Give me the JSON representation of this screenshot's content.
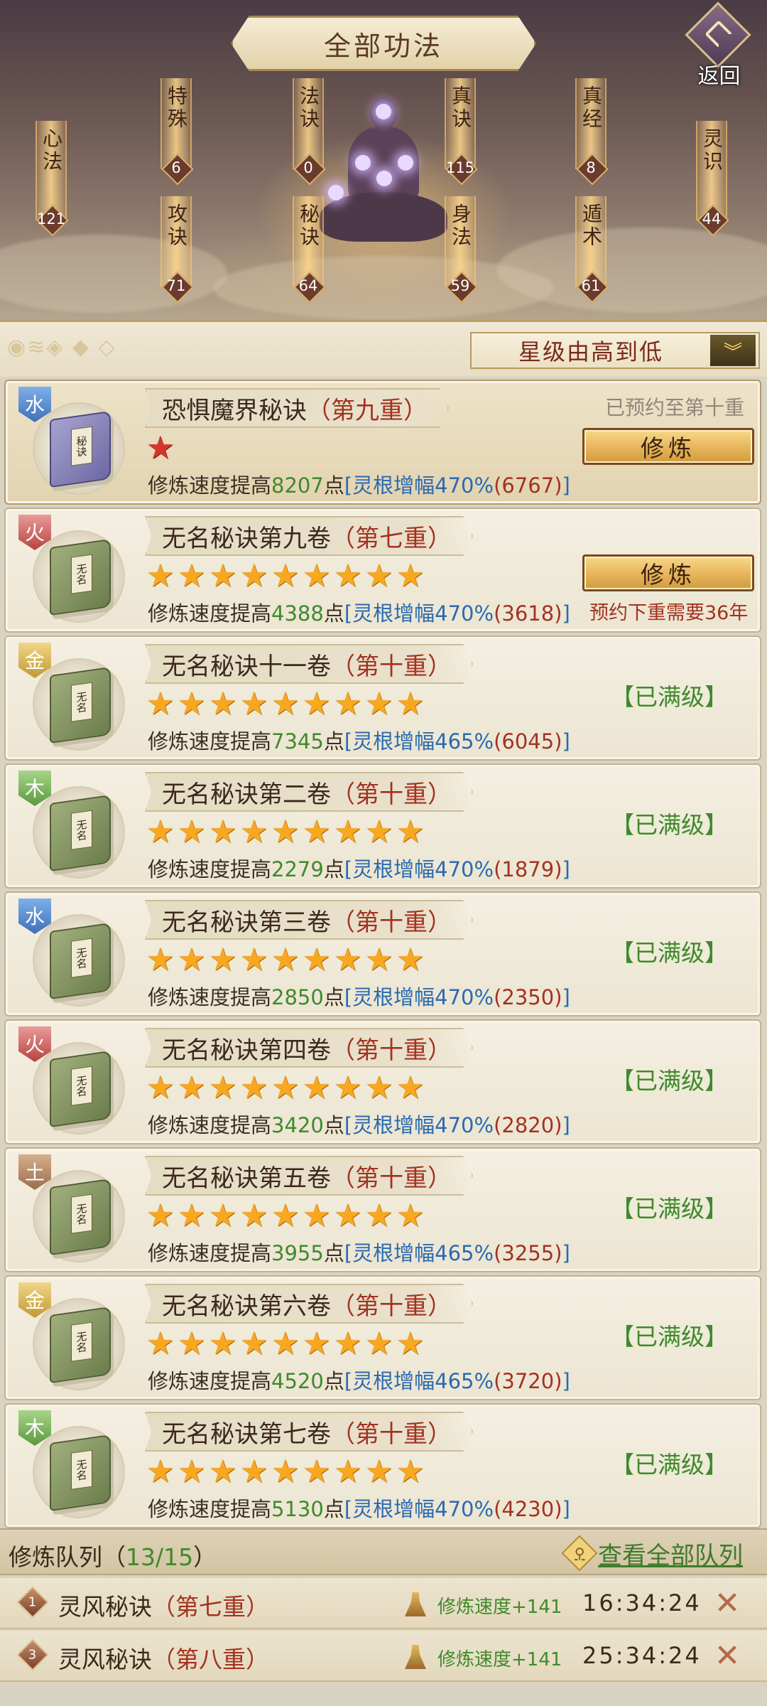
{
  "header": {
    "title": "全部功法",
    "back_label": "返回",
    "categories": [
      {
        "name": "心法",
        "count": "121"
      },
      {
        "name": "特殊",
        "count": "6"
      },
      {
        "name": "攻诀",
        "count": "71"
      },
      {
        "name": "法诀",
        "count": "0"
      },
      {
        "name": "秘诀",
        "count": "64"
      },
      {
        "name": "真诀",
        "count": "115"
      },
      {
        "name": "身法",
        "count": "59"
      },
      {
        "name": "真经",
        "count": "8"
      },
      {
        "name": "遁术",
        "count": "61"
      },
      {
        "name": "灵识",
        "count": "44"
      }
    ]
  },
  "sort": {
    "label": "星级由高到低"
  },
  "cards": [
    {
      "element": "水",
      "name": "恐惧魔界秘诀",
      "tier": "（第九重）",
      "book": "purple",
      "book_label": "秘诀",
      "stars": 1,
      "star_color": "red",
      "stat_prefix": "修炼速度提高",
      "speed": "8207",
      "stat_unit": "点",
      "bonus": "[灵根增幅470%",
      "bonus_value": "(6767)",
      "bracket_close": "]",
      "reserved_note": "已预约至第十重",
      "action": "修炼",
      "next_note": "",
      "maxed": ""
    },
    {
      "element": "火",
      "name": "无名秘诀第九卷",
      "tier": "（第七重）",
      "book": "green",
      "book_label": "无名",
      "stars": 9,
      "star_color": "gold",
      "stat_prefix": "修炼速度提高",
      "speed": "4388",
      "stat_unit": "点",
      "bonus": "[灵根增幅470%",
      "bonus_value": "(3618)",
      "bracket_close": "]",
      "reserved_note": "",
      "action": "修炼",
      "next_note": "预约下重需要36年",
      "maxed": ""
    },
    {
      "element": "金",
      "name": "无名秘诀十一卷",
      "tier": "（第十重）",
      "book": "green",
      "book_label": "无名",
      "stars": 9,
      "star_color": "gold",
      "stat_prefix": "修炼速度提高",
      "speed": "7345",
      "stat_unit": "点",
      "bonus": "[灵根增幅465%",
      "bonus_value": "(6045)",
      "bracket_close": "]",
      "reserved_note": "",
      "action": "",
      "next_note": "",
      "maxed": "【已满级】"
    },
    {
      "element": "木",
      "name": "无名秘诀第二卷",
      "tier": "（第十重）",
      "book": "green",
      "book_label": "无名",
      "stars": 9,
      "star_color": "gold",
      "stat_prefix": "修炼速度提高",
      "speed": "2279",
      "stat_unit": "点",
      "bonus": "[灵根增幅470%",
      "bonus_value": "(1879)",
      "bracket_close": "]",
      "reserved_note": "",
      "action": "",
      "next_note": "",
      "maxed": "【已满级】"
    },
    {
      "element": "水",
      "name": "无名秘诀第三卷",
      "tier": "（第十重）",
      "book": "green",
      "book_label": "无名",
      "stars": 9,
      "star_color": "gold",
      "stat_prefix": "修炼速度提高",
      "speed": "2850",
      "stat_unit": "点",
      "bonus": "[灵根增幅470%",
      "bonus_value": "(2350)",
      "bracket_close": "]",
      "reserved_note": "",
      "action": "",
      "next_note": "",
      "maxed": "【已满级】"
    },
    {
      "element": "火",
      "name": "无名秘诀第四卷",
      "tier": "（第十重）",
      "book": "green",
      "book_label": "无名",
      "stars": 9,
      "star_color": "gold",
      "stat_prefix": "修炼速度提高",
      "speed": "3420",
      "stat_unit": "点",
      "bonus": "[灵根增幅470%",
      "bonus_value": "(2820)",
      "bracket_close": "]",
      "reserved_note": "",
      "action": "",
      "next_note": "",
      "maxed": "【已满级】"
    },
    {
      "element": "土",
      "name": "无名秘诀第五卷",
      "tier": "（第十重）",
      "book": "green",
      "book_label": "无名",
      "stars": 9,
      "star_color": "gold",
      "stat_prefix": "修炼速度提高",
      "speed": "3955",
      "stat_unit": "点",
      "bonus": "[灵根增幅465%",
      "bonus_value": "(3255)",
      "bracket_close": "]",
      "reserved_note": "",
      "action": "",
      "next_note": "",
      "maxed": "【已满级】"
    },
    {
      "element": "金",
      "name": "无名秘诀第六卷",
      "tier": "（第十重）",
      "book": "green",
      "book_label": "无名",
      "stars": 9,
      "star_color": "gold",
      "stat_prefix": "修炼速度提高",
      "speed": "4520",
      "stat_unit": "点",
      "bonus": "[灵根增幅465%",
      "bonus_value": "(3720)",
      "bracket_close": "]",
      "reserved_note": "",
      "action": "",
      "next_note": "",
      "maxed": "【已满级】"
    },
    {
      "element": "木",
      "name": "无名秘诀第七卷",
      "tier": "（第十重）",
      "book": "green",
      "book_label": "无名",
      "stars": 9,
      "star_color": "gold",
      "stat_prefix": "修炼速度提高",
      "speed": "5130",
      "stat_unit": "点",
      "bonus": "[灵根增幅470%",
      "bonus_value": "(4230)",
      "bracket_close": "]",
      "reserved_note": "",
      "action": "",
      "next_note": "",
      "maxed": "【已满级】"
    }
  ],
  "queue": {
    "title": "修炼队列（",
    "count": "13/15",
    "title_close": "）",
    "view_all": "查看全部队列",
    "items": [
      {
        "num": "1",
        "name": "灵风秘诀",
        "tier": "（第七重）",
        "speed": "修炼速度+141",
        "timer": "16:34:24"
      },
      {
        "num": "3",
        "name": "灵风秘诀",
        "tier": "（第八重）",
        "speed": "修炼速度+141",
        "timer": "25:34:24"
      }
    ]
  },
  "colors": {
    "accent_red": "#a3321f",
    "accent_green": "#3f8a2c",
    "accent_blue": "#2a6ab0",
    "star_gold": "#f7a81e"
  }
}
